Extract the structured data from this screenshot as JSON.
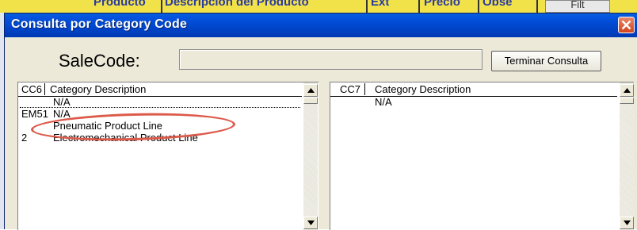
{
  "background": {
    "header_cells": [
      "Producto",
      "Descripcion del Producto",
      "Ext",
      "Precio",
      "Obse"
    ],
    "filter_button": "Filt"
  },
  "dialog": {
    "title": "Consulta  por  Category Code",
    "salecode_label": "SaleCode:",
    "salecode_value": "",
    "end_button": "Terminar Consulta"
  },
  "left_list": {
    "columns": [
      "CC6",
      "Category Description"
    ],
    "rows": [
      {
        "code": "",
        "description": "N/A"
      },
      {
        "code": "EM51",
        "description": "N/A"
      },
      {
        "code": "",
        "description": "Pneumatic Product Line"
      },
      {
        "code": "2",
        "description": "Electromechanical Product Line"
      }
    ]
  },
  "right_list": {
    "columns": [
      "CC7",
      "Category Description"
    ],
    "rows": [
      {
        "code": "",
        "description": "N/A"
      }
    ]
  },
  "colors": {
    "titlebar": "#0054e3",
    "dialog_bg": "#ece9d8",
    "highlight_circle": "#dc5a4a",
    "spreadsheet_header": "#f2e24a"
  }
}
